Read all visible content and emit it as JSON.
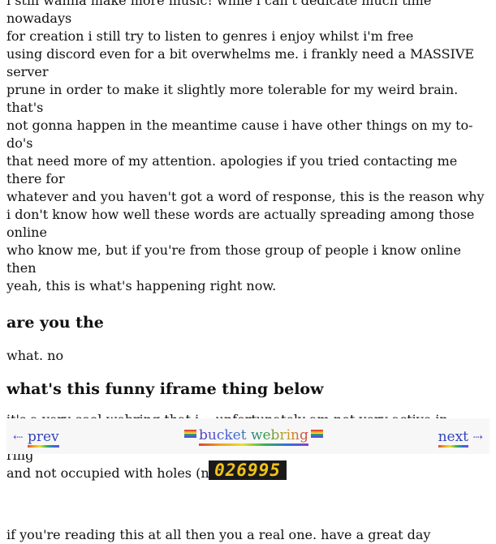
{
  "paragraphs": {
    "intro": "i still wanna make more music! while i can't dedicate much time nowadays\nfor creation i still try to listen to genres i enjoy whilst i'm free\nusing discord even for a bit overwhelms me. i frankly need a MASSIVE server\nprune in order to make it slightly more tolerable for my weird brain. that's\nnot gonna happen in the meantime cause i have other things on my to-do's\nthat need more of my attention. apologies if you tried contacting me there for\nwhatever and you haven't got a word of response, this is the reason why\ni don't know how well these words are actually spreading among those online\nwho know me, but if you're from those group of people i know online then\nyeah, this is what's happening right now.",
    "heading1": "are you the",
    "answer1": "what. no",
    "heading2": "what's this funny iframe thing below",
    "answer2": "it's a very cool webring that i... unfortunately am not very active in\ncontributing. i'm still putting it here to make sure the webring is still a ring\nand not occupied with holes (not literal)",
    "closing": "if you're reading this at all then you a real one. have a great day"
  },
  "webring": {
    "prev_arrow": "⇠",
    "prev_label": "prev",
    "center_label": "bucket webring",
    "next_label": "next",
    "next_arrow": "⇢"
  },
  "counter": {
    "value": "026995"
  }
}
